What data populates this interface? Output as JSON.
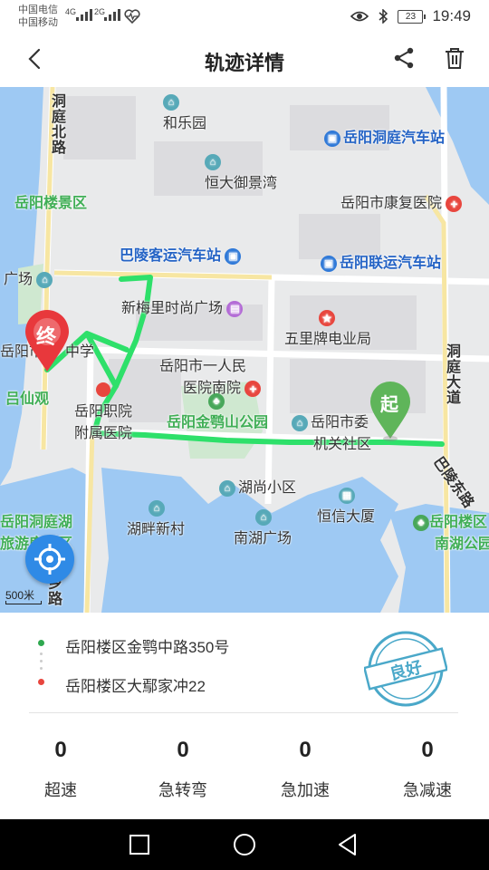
{
  "status_bar": {
    "carrier1": "中国电信",
    "carrier2": "中国移动",
    "net1": "4G",
    "net2": "2G",
    "battery": "23",
    "time": "19:49"
  },
  "header": {
    "title": "轨迹详情"
  },
  "map": {
    "labels": {
      "dongting_north_road": "洞庭北路",
      "hele_garden": "和乐园",
      "yueyang_dongting_bus_station": "岳阳洞庭汽车站",
      "hengda_yujingwan": "恒大御景湾",
      "yueyanglou_scenic": "岳阳楼景区",
      "rehab_hospital": "岳阳市康复医院",
      "baling_bus_station": "巴陵客运汽车站",
      "yueyang_lianyun_station": "岳阳联运汽车站",
      "guangchang": "广场",
      "xinmeili_plaza": "新梅里时尚广场",
      "wulipai_store": "五里牌电业局",
      "yueyang_city_school_a": "岳阳市",
      "yueyang_city_school_b": "中学",
      "lvxianguan": "吕仙观",
      "first_hospital_a": "岳阳市一人民",
      "first_hospital_b": "医院南院",
      "dongting_avenue": "洞庭大道",
      "vocational_hospital_a": "岳阳职院",
      "vocational_hospital_b": "附属医院",
      "jinesshan_park": "岳阳金鹗山公园",
      "committee_a": "岳阳市委",
      "committee_b": "机关社区",
      "bali_road": "巴陵东路",
      "hushang_community": "湖尚小区",
      "dongting_lake_a": "岳阳洞庭湖",
      "dongting_lake_b": "旅游度假区",
      "hupan_village": "湖畔新村",
      "nanhu_plaza": "南湖广场",
      "hengxin_building": "恒信大厦",
      "nanhu_park_a": "岳阳楼区",
      "nanhu_park_b": "南湖公园",
      "xiang_road": "乡路"
    },
    "start_marker": "起",
    "end_marker": "终",
    "scale": "500米",
    "icons": {
      "locate": "crosshair-icon",
      "collapse": "chevron-up-icon"
    },
    "route_color": "#2ee06a"
  },
  "trip": {
    "start_address": "岳阳楼区金鹗中路350号",
    "end_address": "岳阳楼区大鄢家冲22",
    "rating": "良好",
    "stats": [
      {
        "label": "超速",
        "value": "0"
      },
      {
        "label": "急转弯",
        "value": "0"
      },
      {
        "label": "急加速",
        "value": "0"
      },
      {
        "label": "急减速",
        "value": "0"
      }
    ]
  },
  "colors": {
    "start_dot": "#2fa84f",
    "end_dot": "#e8463e",
    "stamp": "#4aa8c9"
  }
}
